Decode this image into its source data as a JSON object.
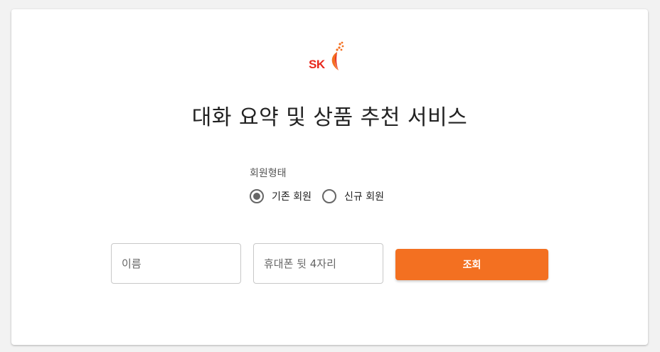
{
  "brand": {
    "logo_text": "SK",
    "logo_color": "#e8281d",
    "accent_color": "#f37021"
  },
  "page": {
    "title": "대화 요약 및 상품 추천 서비스"
  },
  "member_type": {
    "label": "회원형태",
    "options": [
      {
        "label": "기존 회원",
        "selected": true
      },
      {
        "label": "신규 회원",
        "selected": false
      }
    ]
  },
  "form": {
    "name_placeholder": "이름",
    "name_value": "",
    "phone_placeholder": "휴대폰 뒷 4자리",
    "phone_value": "",
    "submit_label": "조회"
  }
}
